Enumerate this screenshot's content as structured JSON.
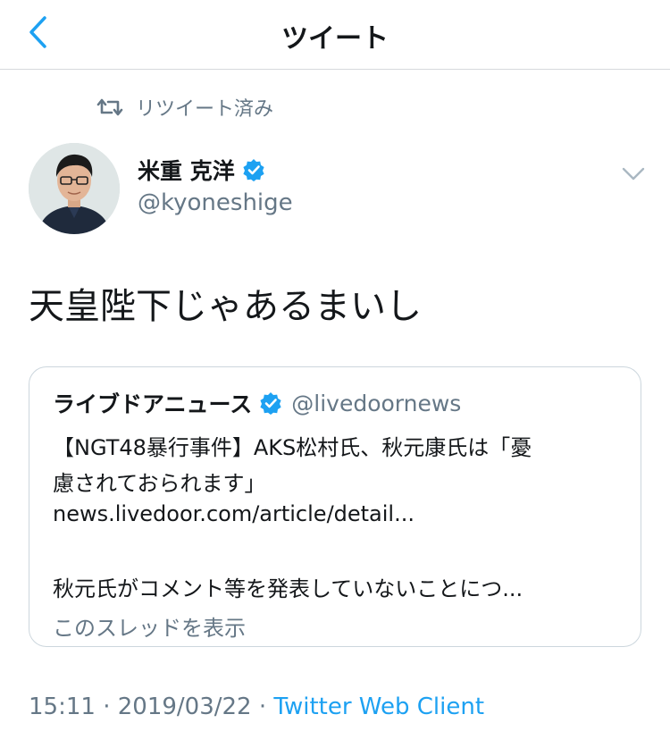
{
  "header": {
    "title": "ツイート",
    "back_icon": "chevron-left-icon"
  },
  "retweet": {
    "label": "リツイート済み",
    "icon": "retweet-icon"
  },
  "author": {
    "name": "米重 克洋",
    "handle": "@kyoneshige",
    "verified": true,
    "verified_color": "#1da1f2"
  },
  "tweet": {
    "text": "天皇陛下じゃあるまいし"
  },
  "quote": {
    "name": "ライブドアニュース",
    "handle": "@livedoornews",
    "verified": true,
    "lines": [
      "【NGT48暴行事件】AKS松村氏、秋元康氏は「憂",
      "慮されておられます」",
      "news.livedoor.com/article/detail...",
      "秋元氏がコメント等を発表していないことにつ..."
    ],
    "show_thread": "このスレッドを表示"
  },
  "meta": {
    "time": "15:11",
    "separator": " · ",
    "date": "2019/03/22",
    "client": "Twitter Web Client"
  },
  "colors": {
    "accent": "#1da1f2",
    "secondary_text": "#657786",
    "border": "#ccd6dd"
  }
}
